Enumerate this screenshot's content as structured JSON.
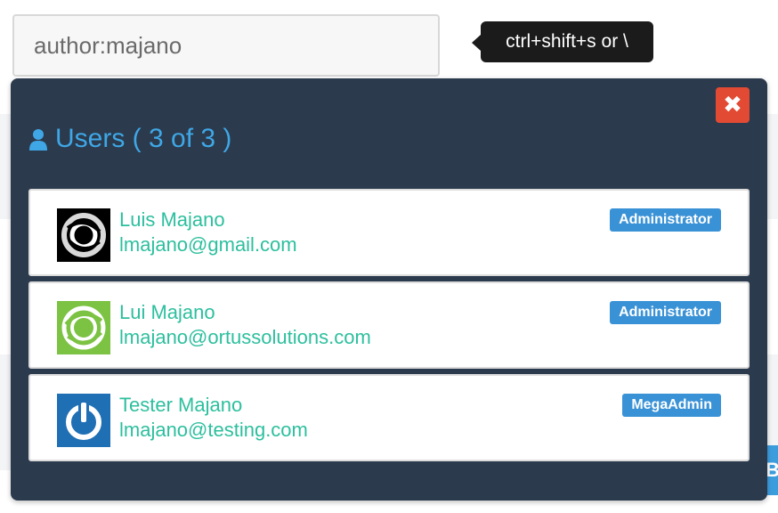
{
  "search": {
    "value": "author:majano"
  },
  "tooltip": {
    "text": "ctrl+shift+s or \\"
  },
  "popup": {
    "title": "Users ( 3 of 3 )",
    "close_icon": "close-icon",
    "title_icon": "user-icon"
  },
  "users": [
    {
      "name": "Luis Majano",
      "email": "lmajano@gmail.com",
      "role": "Administrator",
      "avatar": "swirl-avatar-black"
    },
    {
      "name": "Lui Majano",
      "email": "lmajano@ortussolutions.com",
      "role": "Administrator",
      "avatar": "swirl-avatar-green"
    },
    {
      "name": "Tester Majano",
      "email": "lmajano@testing.com",
      "role": "MegaAdmin",
      "avatar": "power-avatar-blue"
    }
  ],
  "edge_button": {
    "label": "B"
  },
  "colors": {
    "popup_bg": "#2b3a4d",
    "title": "#3fa7e6",
    "user_text": "#2dbf9e",
    "badge": "#3a92d6",
    "close": "#e24a33"
  }
}
